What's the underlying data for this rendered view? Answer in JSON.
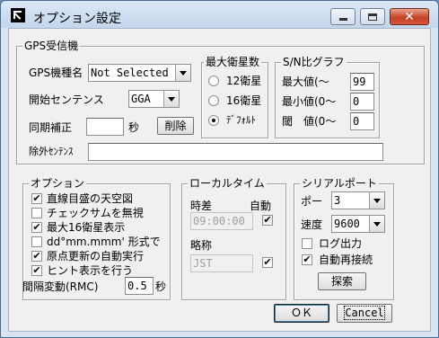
{
  "window": {
    "title": "オプション設定"
  },
  "gps": {
    "group_label": "GPS受信機",
    "model_label": "GPS機種名",
    "model_value": "Not Selected",
    "start_label": "開始センテンス",
    "start_value": "GGA",
    "sync_label": "同期補正",
    "sync_value": "",
    "sync_unit": "秒",
    "delete_label": "削除",
    "exclude_label": "除外ｾﾝﾃﾝｽ",
    "exclude_value": ""
  },
  "max_sat": {
    "group_label": "最大衛星数",
    "options": [
      "12衛星",
      "16衛星",
      "ﾃﾞﾌｫﾙﾄ"
    ],
    "selected_index": 2
  },
  "sn_graph": {
    "group_label": "S/N比グラフ",
    "max_label": "最大値(〜",
    "max_value": "99",
    "min_label": "最小値(0〜",
    "min_value": "0",
    "thresh_label": "閾　値(0〜",
    "thresh_value": "0"
  },
  "options": {
    "group_label": "オプション",
    "items": [
      {
        "label": "直線目盛の天空図",
        "checked": true
      },
      {
        "label": "チェックサムを無視",
        "checked": false
      },
      {
        "label": "最大16衛星表示",
        "checked": true
      },
      {
        "label": "dd°mm.mmm' 形式で",
        "checked": false
      },
      {
        "label": "原点更新の自動実行",
        "checked": true
      },
      {
        "label": "ヒント表示を行う",
        "checked": true
      }
    ],
    "interval_label": "間隔変動(RMC)",
    "interval_value": "0.5",
    "interval_unit": "秒"
  },
  "local_time": {
    "group_label": "ローカルタイム",
    "diff_label": "時差",
    "auto_label": "自動",
    "diff_value": "09:00:00",
    "auto_checked": true,
    "abbr_label": "略称",
    "abbr_value": "JST",
    "abbr_checked": true
  },
  "serial": {
    "group_label": "シリアルポート",
    "port_label": "ポート",
    "port_value": "3",
    "speed_label": "速度",
    "speed_value": "9600",
    "log_label": "ログ出力",
    "log_checked": false,
    "reconnect_label": "自動再接続",
    "reconnect_checked": true,
    "search_label": "探索"
  },
  "footer": {
    "ok_label": "ＯＫ",
    "cancel_label": "Cancel"
  }
}
